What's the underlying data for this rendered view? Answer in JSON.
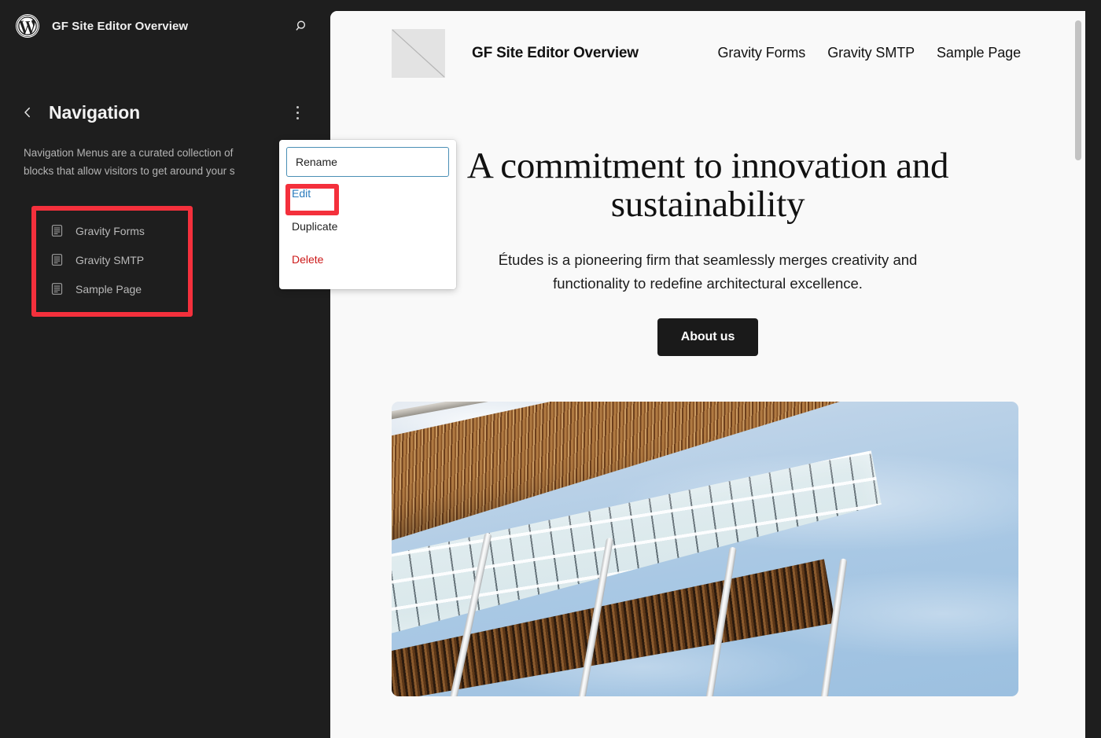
{
  "sidebar": {
    "logo_icon": "wordpress-logo-icon",
    "site_title": "GF Site Editor Overview",
    "search_icon": "search-icon",
    "back_icon": "chevron-left-icon",
    "panel_heading": "Navigation",
    "kebab_icon": "more-options-icon",
    "description": "Navigation Menus are a curated collection of blocks that allow visitors to get around your s",
    "menu_items": [
      {
        "label": "Gravity Forms",
        "icon": "page-icon"
      },
      {
        "label": "Gravity SMTP",
        "icon": "page-icon"
      },
      {
        "label": "Sample Page",
        "icon": "page-icon"
      }
    ]
  },
  "popup": {
    "rename_value": "Rename",
    "rename_placeholder": "Rename",
    "items": [
      {
        "label": "Edit",
        "state": "highlighted"
      },
      {
        "label": "Duplicate",
        "state": "default"
      },
      {
        "label": "Delete",
        "state": "destructive"
      }
    ]
  },
  "annotations": {
    "color": "#f4303c",
    "menu_list_box": "nav-menu-items-highlight",
    "edit_box": "edit-menu-item-highlight"
  },
  "canvas": {
    "site_header": {
      "logo_icon": "site-logo-placeholder-icon",
      "site_name": "GF Site Editor Overview",
      "nav_links": [
        "Gravity Forms",
        "Gravity SMTP",
        "Sample Page"
      ]
    },
    "hero": {
      "heading": "A commitment to innovation and sustainability",
      "paragraph": "Études is a pioneering firm that seamlessly merges creativity and functionality to redefine architectural excellence.",
      "button_label": "About us"
    },
    "media": {
      "alt": "Modern architectural canopy with wooden slats, glass roof panels and white columns against a blue sky"
    }
  },
  "colors": {
    "sidebar_bg": "#1e1e1e",
    "canvas_bg": "#f9f9f9",
    "accent_red": "#f4303c",
    "link_blue": "#2a7bbd",
    "delete_red": "#cc1818",
    "button_dark": "#1a1a1a"
  }
}
